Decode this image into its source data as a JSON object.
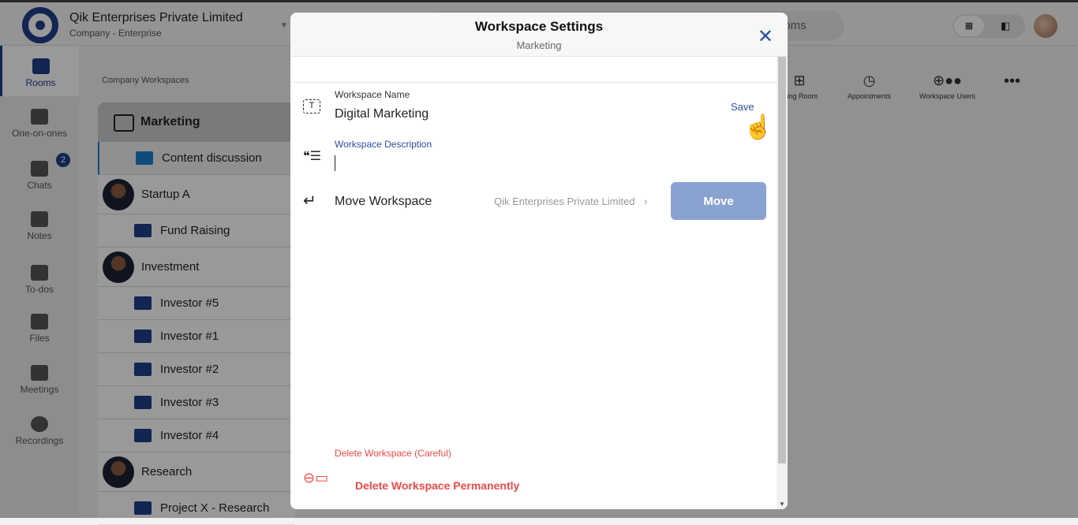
{
  "header": {
    "company_name": "Qik Enterprises Private Limited",
    "company_type": "Company - Enterprise",
    "search_placeholder": "Search Rooms",
    "search_visible": "ooms"
  },
  "sidebar": {
    "items": [
      {
        "label": "Rooms",
        "icon": "rooms-icon",
        "active": true
      },
      {
        "label": "One-on-ones",
        "icon": "people-icon"
      },
      {
        "label": "Chats",
        "icon": "chat-icon",
        "badge": "2"
      },
      {
        "label": "Notes",
        "icon": "notes-icon"
      },
      {
        "label": "To-dos",
        "icon": "checkbox-icon"
      },
      {
        "label": "Files",
        "icon": "files-icon"
      },
      {
        "label": "Meetings",
        "icon": "calendar-icon"
      },
      {
        "label": "Recordings",
        "icon": "waveform-icon"
      }
    ]
  },
  "workspaces": {
    "breadcrumb": "Company Workspaces",
    "current": "Marketing",
    "rooms": {
      "marketing": "Content discussion",
      "startup": "Startup A",
      "fund": "Fund Raising",
      "investment": "Investment",
      "inv5": "Investor #5",
      "inv1": "Investor #1",
      "inv2": "Investor #2",
      "inv3": "Investor #3",
      "inv4": "Investor #4",
      "research": "Research",
      "projx": "Project X - Research"
    }
  },
  "toolbar": {
    "meeting_room": "eting Room",
    "appointments": "Appointments",
    "workspace_users": "Workspace Users"
  },
  "modal": {
    "title": "Workspace Settings",
    "subtitle": "Marketing",
    "name_label": "Workspace Name",
    "name_value": "Digital Marketing",
    "save_label": "Save",
    "desc_label": "Workspace Description",
    "desc_value": "",
    "move_label": "Move Workspace",
    "move_destination": "Qik Enterprises Private Limited",
    "move_button": "Move",
    "delete_label": "Delete Workspace (Careful)",
    "delete_button": "Delete Workspace Permanently"
  },
  "colors": {
    "accent": "#1f3f8a",
    "link": "#2a4fa0",
    "danger": "#f24848",
    "move_button": "#8aa2cf"
  }
}
